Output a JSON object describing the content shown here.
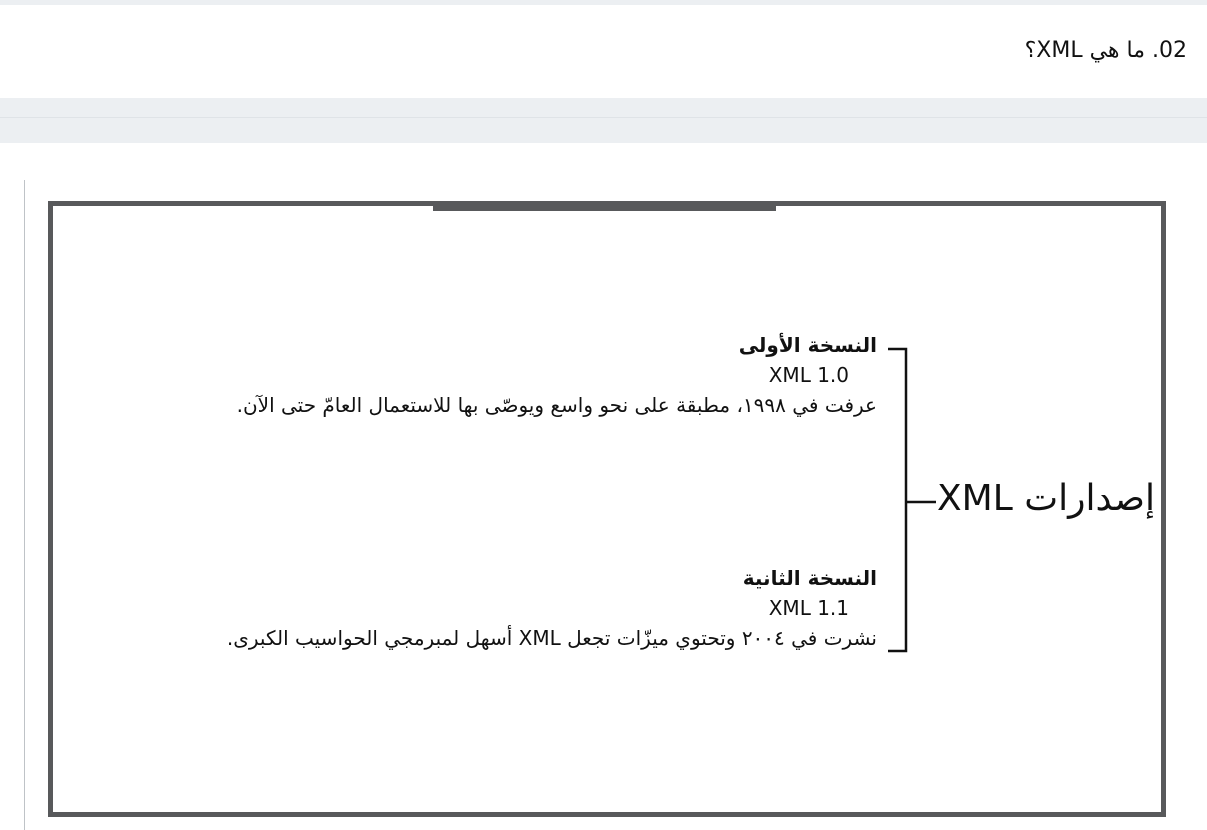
{
  "heading": "02. ما هي XML؟",
  "diagram": {
    "main_label": "إصدارات XML",
    "versions": [
      {
        "title": "النسخة الأولى",
        "version": "XML 1.0",
        "description": "عرفت في ١٩٩٨، مطبقة على نحو واسع ويوصّى بها للاستعمال العامّ حتى الآن."
      },
      {
        "title": "النسخة الثانية",
        "version": "XML 1.1",
        "description": "نشرت في ٢٠٠٤ وتحتوي ميزّات تجعل XML  أسهل لمبرمجي الحواسيب الكبرى."
      }
    ]
  },
  "colors": {
    "frame": "#58595b",
    "band": "#eceff2",
    "text": "#111111"
  }
}
